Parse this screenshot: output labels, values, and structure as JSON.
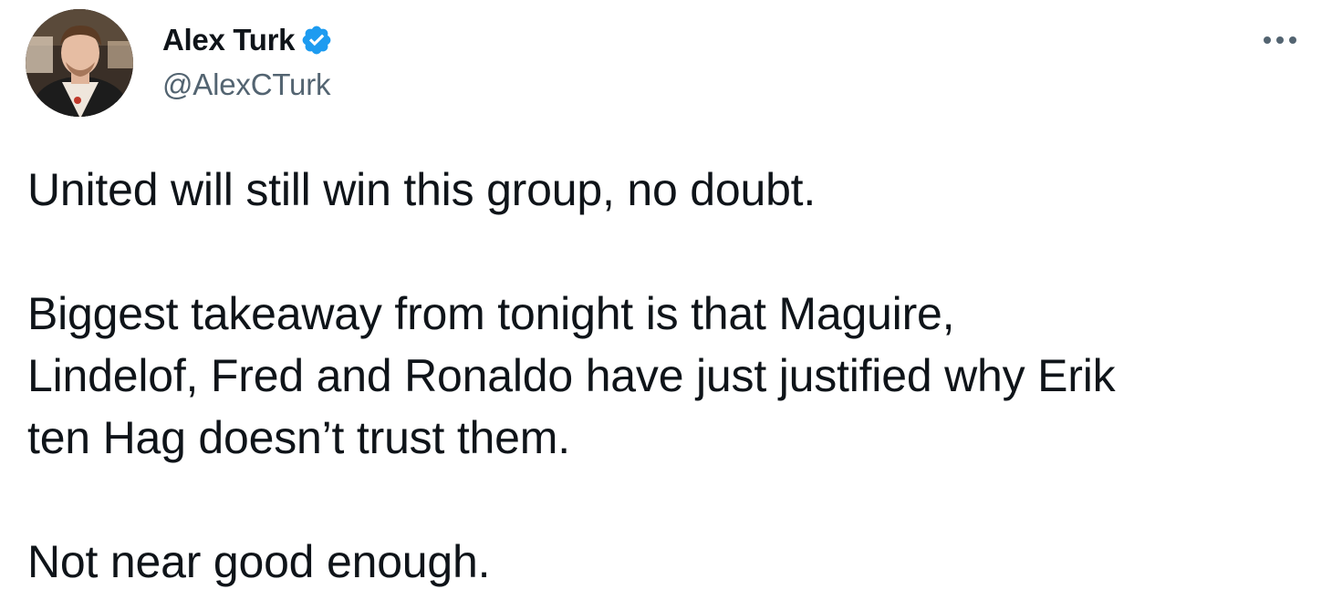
{
  "author": {
    "display_name": "Alex Turk",
    "handle": "@AlexCTurk",
    "verified": true,
    "verified_color": "#1d9bf0"
  },
  "icons": {
    "avatar": "user-avatar-photo",
    "verified": "verified-badge-icon",
    "more": "more-horizontal-icon"
  },
  "tweet": {
    "paragraph_1": "United will still win this group, no doubt.",
    "paragraph_2": "Biggest takeaway from tonight is that Maguire,\nLindelof, Fred and Ronaldo have just justified why Erik\nten Hag doesn’t trust them.",
    "paragraph_3": "Not near good enough."
  },
  "colors": {
    "text_primary": "#0f1419",
    "text_secondary": "#536471",
    "accent": "#1d9bf0"
  }
}
